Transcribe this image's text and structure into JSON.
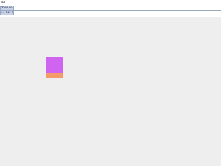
{
  "top_link": {
    "text": "ab"
  },
  "fields": [
    {
      "label": "Your name",
      "value": ""
    },
    {
      "label": "... our name",
      "value": ""
    }
  ],
  "colors": {
    "page_bg": "#eeeeee",
    "purple_rect": "#cf64f1",
    "orange_rect": "#f59a69",
    "label_bg": "#c8d2e6"
  }
}
